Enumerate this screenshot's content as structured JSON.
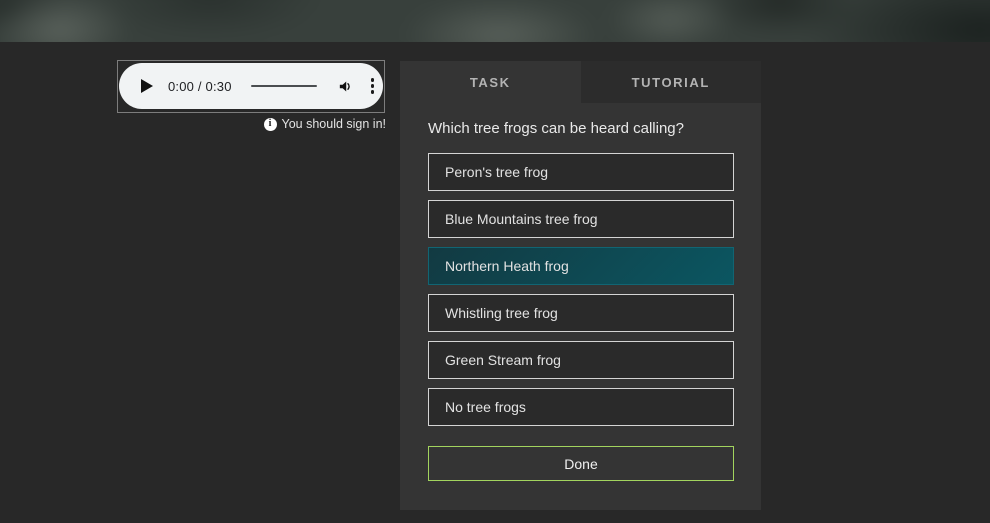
{
  "audio_player": {
    "time_display": "0:00 / 0:30",
    "current_time": "0:00",
    "duration": "0:30"
  },
  "signin_note": {
    "text": "You should sign in!"
  },
  "panel": {
    "tabs": [
      {
        "label": "TASK",
        "active": true
      },
      {
        "label": "TUTORIAL",
        "active": false
      }
    ],
    "question": "Which tree frogs can be heard calling?",
    "options": [
      {
        "label": "Peron's tree frog",
        "selected": false
      },
      {
        "label": "Blue Mountains tree frog",
        "selected": false
      },
      {
        "label": "Northern Heath frog",
        "selected": true
      },
      {
        "label": "Whistling tree frog",
        "selected": false
      },
      {
        "label": "Green Stream frog",
        "selected": false
      },
      {
        "label": "No tree frogs",
        "selected": false
      }
    ],
    "done_label": "Done"
  },
  "colors": {
    "page-bg": "#282828",
    "hero-base": "#38403c",
    "panel-bg": "#343434",
    "tab-inactive-bg": "#2c2c2c",
    "tab-text": "#b3b3b3",
    "option-bg": "#2a2a2a",
    "option-border": "#d4d4d4",
    "option-text": "#e2e2e2",
    "selected-start": "#123a42",
    "selected-end": "#0b5661",
    "selected-border": "#116573",
    "done-border": "#a2d45e",
    "text-light": "#e9e9e9",
    "pill-bg": "#f1f3f4",
    "pill-text": "#202124"
  }
}
